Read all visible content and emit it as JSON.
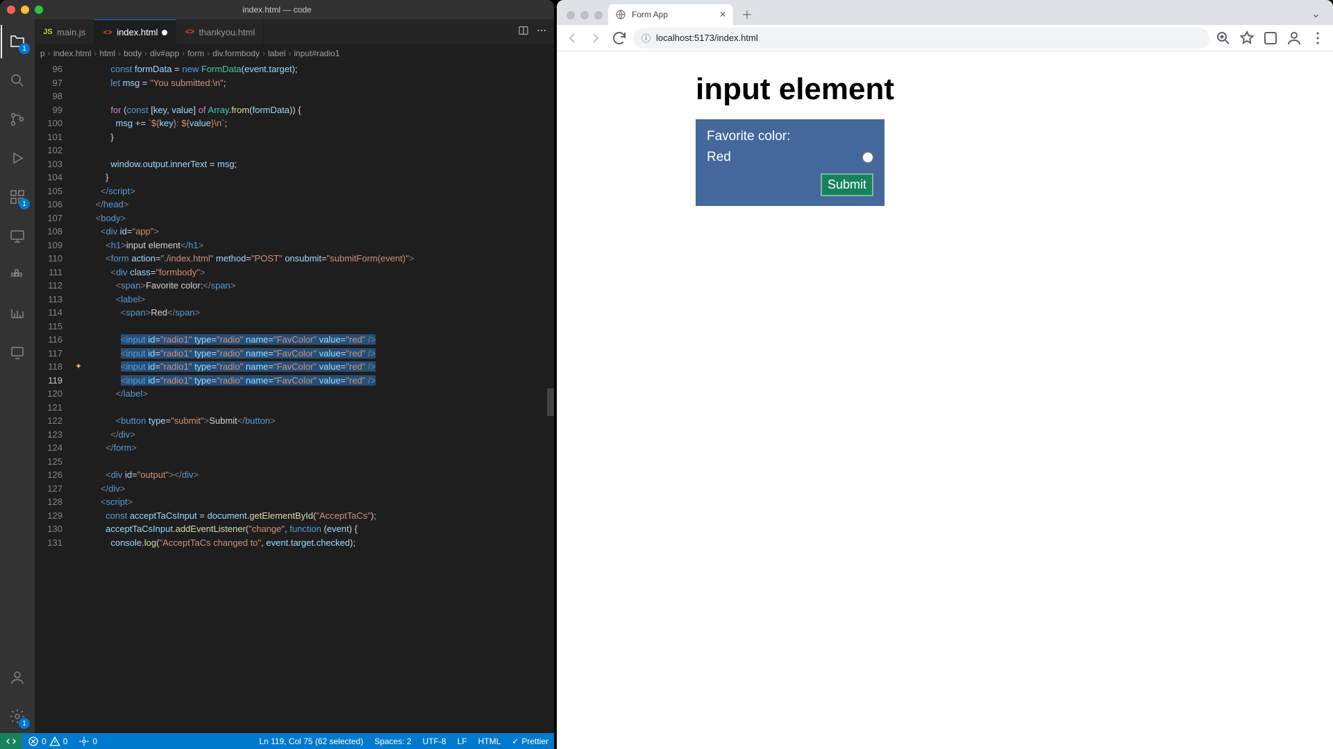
{
  "vscode": {
    "title": "index.html — code",
    "tabs": [
      {
        "icon": "JS",
        "iconClass": "js",
        "label": "main.js",
        "active": false,
        "dirty": false
      },
      {
        "icon": "<>",
        "iconClass": "html",
        "label": "index.html",
        "active": true,
        "dirty": true
      },
      {
        "icon": "<>",
        "iconClass": "html",
        "label": "thankyou.html",
        "active": false,
        "dirty": false
      }
    ],
    "breadcrumbs": [
      "p",
      "index.html",
      "html",
      "body",
      "div#app",
      "form",
      "div.formbody",
      "label",
      "input#radio1"
    ],
    "activity_badges": {
      "explorer": "1",
      "extensions": "1"
    },
    "line_start": 96,
    "current_line": 119,
    "glyph_line": 118,
    "statusbar": {
      "errors": "0",
      "warnings": "0",
      "ports": "0",
      "cursor": "Ln 119, Col 75 (62 selected)",
      "spaces": "Spaces: 2",
      "encoding": "UTF-8",
      "eol": "LF",
      "lang": "HTML",
      "prettier": "Prettier"
    },
    "code_lines": [
      {
        "n": 96,
        "html": "            <span class='kw'>const</span> <span class='vr'>formData</span> <span class='pn'>=</span> <span class='kw'>new</span> <span class='cls'>FormData</span><span class='pn'>(</span><span class='vr'>event</span><span class='pn'>.</span><span class='vr'>target</span><span class='pn'>);</span>"
      },
      {
        "n": 97,
        "html": "            <span class='kw'>let</span> <span class='vr'>msg</span> <span class='pn'>=</span> <span class='st'>\"You submitted:\\n\"</span><span class='pn'>;</span>"
      },
      {
        "n": 98,
        "html": " "
      },
      {
        "n": 99,
        "html": "            <span class='kw2'>for</span> <span class='pn'>(</span><span class='kw'>const</span> <span class='pn'>[</span><span class='vr'>key</span><span class='pn'>,</span> <span class='vr'>value</span><span class='pn'>]</span> <span class='kw2'>of</span> <span class='cls'>Array</span><span class='pn'>.</span><span class='fn'>from</span><span class='pn'>(</span><span class='vr'>formData</span><span class='pn'>)) {</span>"
      },
      {
        "n": 100,
        "html": "              <span class='vr'>msg</span> <span class='pn'>+=</span> <span class='st'>`${</span><span class='vr'>key</span><span class='st'>}: ${</span><span class='vr'>value</span><span class='st'>}\\n`</span><span class='pn'>;</span>"
      },
      {
        "n": 101,
        "html": "            <span class='pn'>}</span>"
      },
      {
        "n": 102,
        "html": " "
      },
      {
        "n": 103,
        "html": "            <span class='vr'>window</span><span class='pn'>.</span><span class='vr'>output</span><span class='pn'>.</span><span class='vr'>innerText</span> <span class='pn'>=</span> <span class='vr'>msg</span><span class='pn'>;</span>"
      },
      {
        "n": 104,
        "html": "          <span class='pn'>}</span>"
      },
      {
        "n": 105,
        "html": "        <span class='br'>&lt;/</span><span class='tg'>script</span><span class='br'>&gt;</span>"
      },
      {
        "n": 106,
        "html": "      <span class='br'>&lt;/</span><span class='tg'>head</span><span class='br'>&gt;</span>"
      },
      {
        "n": 107,
        "html": "      <span class='br'>&lt;</span><span class='tg'>body</span><span class='br'>&gt;</span>"
      },
      {
        "n": 108,
        "html": "        <span class='br'>&lt;</span><span class='tg'>div</span> <span class='at'>id</span><span class='pn'>=</span><span class='st'>\"app\"</span><span class='br'>&gt;</span>"
      },
      {
        "n": 109,
        "html": "          <span class='br'>&lt;</span><span class='tg'>h1</span><span class='br'>&gt;</span>input element<span class='br'>&lt;/</span><span class='tg'>h1</span><span class='br'>&gt;</span>"
      },
      {
        "n": 110,
        "html": "          <span class='br'>&lt;</span><span class='tg'>form</span> <span class='at'>action</span><span class='pn'>=</span><span class='st'>\"./index.html\"</span> <span class='at'>method</span><span class='pn'>=</span><span class='st'>\"POST\"</span> <span class='at'>onsubmit</span><span class='pn'>=</span><span class='st'>\"submitForm(event)\"</span><span class='br'>&gt;</span>"
      },
      {
        "n": 111,
        "html": "            <span class='br'>&lt;</span><span class='tg'>div</span> <span class='at'>class</span><span class='pn'>=</span><span class='st'>\"formbody\"</span><span class='br'>&gt;</span>"
      },
      {
        "n": 112,
        "html": "              <span class='br'>&lt;</span><span class='tg'>span</span><span class='br'>&gt;</span>Favorite color:<span class='br'>&lt;/</span><span class='tg'>span</span><span class='br'>&gt;</span>"
      },
      {
        "n": 113,
        "html": "              <span class='br'>&lt;</span><span class='tg'>label</span><span class='br'>&gt;</span>"
      },
      {
        "n": 114,
        "html": "                <span class='br'>&lt;</span><span class='tg'>span</span><span class='br'>&gt;</span>Red<span class='br'>&lt;/</span><span class='tg'>span</span><span class='br'>&gt;</span>"
      },
      {
        "n": 115,
        "html": " "
      },
      {
        "n": 116,
        "html": "                <span class='sel'><span class='br'>&lt;</span><span class='tg'>input</span> <span class='at'>id</span><span class='pn'>=</span><span class='st'>\"radio1\"</span> <span class='at'>type</span><span class='pn'>=</span><span class='st'>\"radio\"</span> <span class='at'>name</span><span class='pn'>=</span><span class='st'>\"FavColor\"</span> <span class='at'>value</span><span class='pn'>=</span><span class='st'>\"red\"</span> <span class='br'>/&gt;</span></span>"
      },
      {
        "n": 117,
        "html": "                <span class='sel'><span class='br'>&lt;</span><span class='tg'>input</span> <span class='at'>id</span><span class='pn'>=</span><span class='st'>\"radio1\"</span> <span class='at'>type</span><span class='pn'>=</span><span class='st'>\"radio\"</span> <span class='at'>name</span><span class='pn'>=</span><span class='st'>\"FavColor\"</span> <span class='at'>value</span><span class='pn'>=</span><span class='st'>\"red\"</span> <span class='br'>/&gt;</span></span>"
      },
      {
        "n": 118,
        "html": "                <span class='sel'><span class='br'>&lt;</span><span class='tg'>input</span> <span class='at'>id</span><span class='pn'>=</span><span class='st'>\"radio1\"</span> <span class='at'>type</span><span class='pn'>=</span><span class='st'>\"radio\"</span> <span class='at'>name</span><span class='pn'>=</span><span class='st'>\"FavColor\"</span> <span class='at'>value</span><span class='pn'>=</span><span class='st'>\"red\"</span> <span class='br'>/&gt;</span></span>"
      },
      {
        "n": 119,
        "html": "                <span class='sel'><span class='br'>&lt;</span><span class='tg'>input</span> <span class='at'>id</span><span class='pn'>=</span><span class='st'>\"radio1\"</span> <span class='at'>type</span><span class='pn'>=</span><span class='st'>\"radio\"</span> <span class='at'>name</span><span class='pn'>=</span><span class='st'>\"FavColor\"</span> <span class='at'>value</span><span class='pn'>=</span><span class='st'>\"red\"</span> <span class='br'>/&gt;</span></span>"
      },
      {
        "n": 120,
        "html": "              <span class='br'>&lt;/</span><span class='tg'>label</span><span class='br'>&gt;</span>"
      },
      {
        "n": 121,
        "html": " "
      },
      {
        "n": 122,
        "html": "              <span class='br'>&lt;</span><span class='tg'>button</span> <span class='at'>type</span><span class='pn'>=</span><span class='st'>\"submit\"</span><span class='br'>&gt;</span>Submit<span class='br'>&lt;/</span><span class='tg'>button</span><span class='br'>&gt;</span>"
      },
      {
        "n": 123,
        "html": "            <span class='br'>&lt;/</span><span class='tg'>div</span><span class='br'>&gt;</span>"
      },
      {
        "n": 124,
        "html": "          <span class='br'>&lt;/</span><span class='tg'>form</span><span class='br'>&gt;</span>"
      },
      {
        "n": 125,
        "html": " "
      },
      {
        "n": 126,
        "html": "          <span class='br'>&lt;</span><span class='tg'>div</span> <span class='at'>id</span><span class='pn'>=</span><span class='st'>\"output\"</span><span class='br'>&gt;&lt;/</span><span class='tg'>div</span><span class='br'>&gt;</span>"
      },
      {
        "n": 127,
        "html": "        <span class='br'>&lt;/</span><span class='tg'>div</span><span class='br'>&gt;</span>"
      },
      {
        "n": 128,
        "html": "        <span class='br'>&lt;</span><span class='tg'>script</span><span class='br'>&gt;</span>"
      },
      {
        "n": 129,
        "html": "          <span class='kw'>const</span> <span class='vr'>acceptTaCsInput</span> <span class='pn'>=</span> <span class='vr'>document</span><span class='pn'>.</span><span class='fn'>getElementById</span><span class='pn'>(</span><span class='st'>\"AcceptTaCs\"</span><span class='pn'>);</span>"
      },
      {
        "n": 130,
        "html": "          <span class='vr'>acceptTaCsInput</span><span class='pn'>.</span><span class='fn'>addEventListener</span><span class='pn'>(</span><span class='st'>\"change\"</span><span class='pn'>,</span> <span class='kw'>function</span> <span class='pn'>(</span><span class='vr'>event</span><span class='pn'>) {</span>"
      },
      {
        "n": 131,
        "html": "            <span class='vr'>console</span><span class='pn'>.</span><span class='fn'>log</span><span class='pn'>(</span><span class='st'>\"AcceptTaCs changed to\"</span><span class='pn'>,</span> <span class='vr'>event</span><span class='pn'>.</span><span class='vr'>target</span><span class='pn'>.</span><span class='vr'>checked</span><span class='pn'>);</span>"
      }
    ]
  },
  "browser": {
    "tab_title": "Form App",
    "url": "localhost:5173/index.html",
    "page": {
      "heading": "input element",
      "form_label": "Favorite color:",
      "option": "Red",
      "submit": "Submit"
    }
  }
}
